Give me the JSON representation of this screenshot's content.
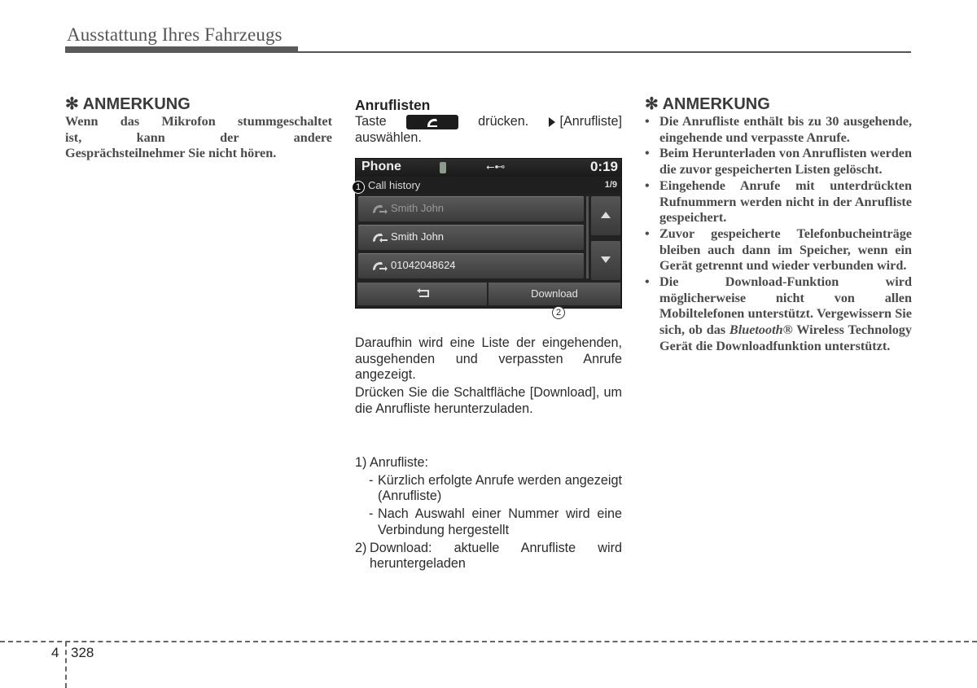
{
  "header": {
    "title": "Ausstattung Ihres Fahrzeugs"
  },
  "left_note": {
    "title": "✻ ANMERKUNG",
    "lines": [
      "Wenn das Mikrofon stummgeschaltet",
      "ist, kann der andere",
      "Gesprächsteilnehmer Sie nicht hören."
    ]
  },
  "middle": {
    "section_title": "Anruflisten",
    "instruction": {
      "before": "Taste",
      "after": "drücken.",
      "target": "[Anrufliste]",
      "line2": "auswählen."
    },
    "screen": {
      "title": "Phone",
      "icons": [
        "bluetooth-icon",
        "usb-icon"
      ],
      "time": "0:19",
      "subtitle": "Call history",
      "page": "1/9",
      "marker1": "1",
      "marker2": "2",
      "rows": [
        {
          "type": "outgoing",
          "label": "Smith John",
          "dim": true
        },
        {
          "type": "incoming",
          "label": "Smith John",
          "dim": false
        },
        {
          "type": "outgoing",
          "label": "01042048624",
          "dim": false
        }
      ],
      "back_label": "back",
      "download_label": "Download"
    },
    "description": [
      "Daraufhin wird eine Liste der eingehenden, ausgehenden und verpassten Anrufe angezeigt.",
      "Drücken Sie die Schaltfläche [Download], um die Anrufliste herunterzuladen."
    ],
    "list": [
      {
        "num": "1)",
        "text": "Anrufliste:",
        "sub": [
          "Kürzlich erfolgte Anrufe werden angezeigt (Anrufliste)",
          "Nach Auswahl einer Nummer wird eine Verbindung hergestellt"
        ]
      },
      {
        "num": "2)",
        "text": "Download: aktuelle Anrufliste wird heruntergeladen",
        "sub": []
      }
    ]
  },
  "right_note": {
    "title": "✻ ANMERKUNG",
    "bullets": [
      "Die Anrufliste enthält bis zu 30 ausgehende, eingehende und verpasste Anrufe.",
      "Beim Herunterladen von Anruflisten werden die zuvor gespeicherten Listen gelöscht.",
      "Eingehende Anrufe mit unterdrückten Rufnummern werden nicht in der Anrufliste gespeichert.",
      "Zuvor gespeicherte Telefonbucheinträge bleiben auch dann im Speicher, wenn ein Gerät getrennt und wieder verbunden wird.",
      "Die Download-Funktion wird möglicherweise nicht von allen Mobiltelefonen unterstützt. Vergewissern Sie sich, ob das"
    ],
    "last_bullet_italic": "Bluetooth®",
    "last_bullet_tail": " Wireless Technology Gerät die Downloadfunktion unterstützt."
  },
  "footer": {
    "chapter": "4",
    "page": "328"
  }
}
